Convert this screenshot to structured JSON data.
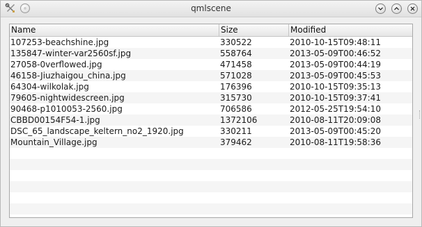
{
  "window": {
    "title": "qmlscene"
  },
  "table": {
    "columns": [
      "Name",
      "Size",
      "Modified"
    ],
    "rows": [
      {
        "name": "107253-beachshine.jpg",
        "size": "330522",
        "modified": "2010-10-15T09:48:11"
      },
      {
        "name": "135847-winter-var2560sf.jpg",
        "size": "558764",
        "modified": "2013-05-09T00:46:52"
      },
      {
        "name": "27058-0verflowed.jpg",
        "size": "471458",
        "modified": "2013-05-09T00:44:19"
      },
      {
        "name": "46158-Jiuzhaigou_china.jpg",
        "size": "571028",
        "modified": "2013-05-09T00:45:53"
      },
      {
        "name": "64304-wilkolak.jpg",
        "size": "176396",
        "modified": "2010-10-15T09:35:13"
      },
      {
        "name": "79605-nightwidescreen.jpg",
        "size": "315730",
        "modified": "2010-10-15T09:37:41"
      },
      {
        "name": "90468-p1010053-2560.jpg",
        "size": "706586",
        "modified": "2012-05-25T19:54:10"
      },
      {
        "name": "CBBD00154F54-1.jpg",
        "size": "1372106",
        "modified": "2010-08-11T20:09:08"
      },
      {
        "name": "DSC_65_landscape_keltern_no2_1920.jpg",
        "size": "330211",
        "modified": "2013-05-09T00:45:20"
      },
      {
        "name": "Mountain_Village.jpg",
        "size": "379462",
        "modified": "2010-08-11T19:58:36"
      }
    ]
  }
}
